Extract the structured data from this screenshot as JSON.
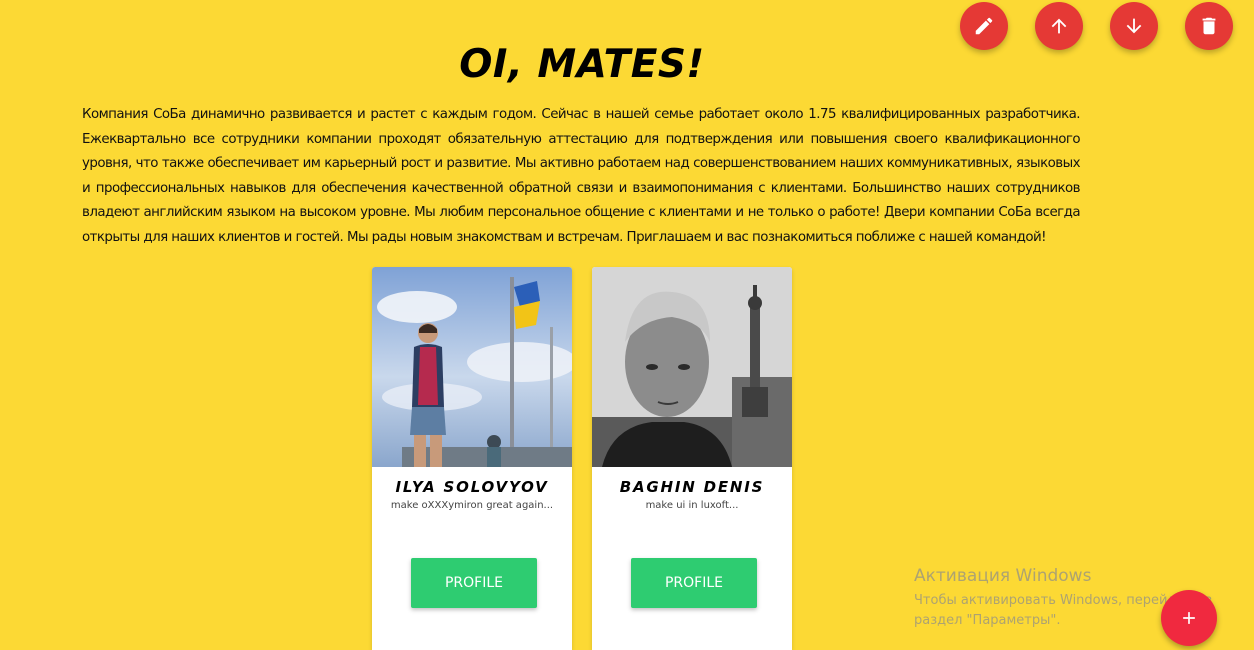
{
  "toolbar": {
    "buttons": [
      {
        "icon": "pencil-icon",
        "action": "edit"
      },
      {
        "icon": "arrow-up-icon",
        "action": "move-up"
      },
      {
        "icon": "arrow-down-icon",
        "action": "move-down"
      },
      {
        "icon": "trash-icon",
        "action": "delete"
      }
    ],
    "accent_color": "#e53935"
  },
  "header": {
    "title": "OI, MATES!"
  },
  "intro": {
    "text": "Компания СоБа динамично развивается и растет с каждым годом. Сейчас в нашей семье работает около 1.75 квалифицированных разработчика. Ежеквартально все сотрудники компании проходят обязательную аттестацию для подтверждения или повышения своего квалификационного уровня, что также обеспечивает им карьерный рост и развитие. Мы активно работаем над совершенствованием наших коммуникативных, языковых и профессиональных навыков для обеспечения качественной обратной связи и взаимопонимания с клиентами. Большинство наших сотрудников владеют английским языком на высоком уровне. Мы любим персональное общение с клиентами и не только о работе! Двери компании СоБа всегда открыты для наших клиентов и гостей. Мы рады новым знакомствам и встречам. Приглашаем и вас познакомиться поближе с нашей командой!"
  },
  "team": [
    {
      "name": "ILYA SOLOVYOV",
      "description": "make oXXXymiron great again...",
      "button_label": "PROFILE"
    },
    {
      "name": "BAGHIN DENIS",
      "description": "make ui in luxoft...",
      "button_label": "PROFILE"
    }
  ],
  "watermark": {
    "line1": "Активация Windows",
    "line2": "Чтобы активировать Windows, перейдите в раздел \"Параметры\"."
  },
  "colors": {
    "background": "#fcd934",
    "profile_button": "#2ecc71",
    "add_button": "#f0293f"
  }
}
